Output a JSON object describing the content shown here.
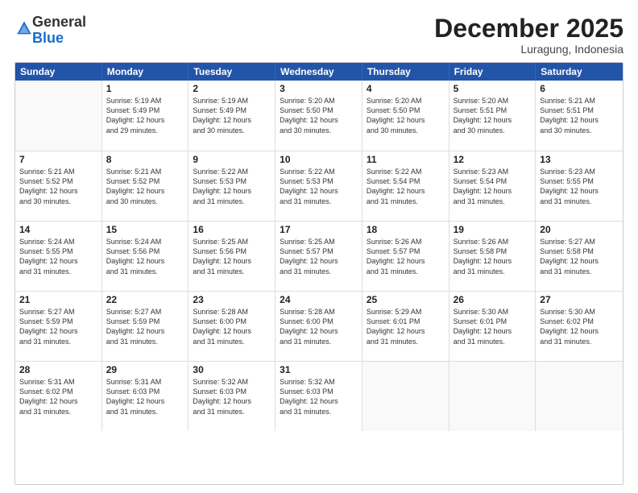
{
  "header": {
    "logo_general": "General",
    "logo_blue": "Blue",
    "month_title": "December 2025",
    "location": "Luragung, Indonesia"
  },
  "days_of_week": [
    "Sunday",
    "Monday",
    "Tuesday",
    "Wednesday",
    "Thursday",
    "Friday",
    "Saturday"
  ],
  "weeks": [
    [
      {
        "day": null,
        "info": null
      },
      {
        "day": "1",
        "info": "Sunrise: 5:19 AM\nSunset: 5:49 PM\nDaylight: 12 hours\nand 29 minutes."
      },
      {
        "day": "2",
        "info": "Sunrise: 5:19 AM\nSunset: 5:49 PM\nDaylight: 12 hours\nand 30 minutes."
      },
      {
        "day": "3",
        "info": "Sunrise: 5:20 AM\nSunset: 5:50 PM\nDaylight: 12 hours\nand 30 minutes."
      },
      {
        "day": "4",
        "info": "Sunrise: 5:20 AM\nSunset: 5:50 PM\nDaylight: 12 hours\nand 30 minutes."
      },
      {
        "day": "5",
        "info": "Sunrise: 5:20 AM\nSunset: 5:51 PM\nDaylight: 12 hours\nand 30 minutes."
      },
      {
        "day": "6",
        "info": "Sunrise: 5:21 AM\nSunset: 5:51 PM\nDaylight: 12 hours\nand 30 minutes."
      }
    ],
    [
      {
        "day": "7",
        "info": "Sunrise: 5:21 AM\nSunset: 5:52 PM\nDaylight: 12 hours\nand 30 minutes."
      },
      {
        "day": "8",
        "info": "Sunrise: 5:21 AM\nSunset: 5:52 PM\nDaylight: 12 hours\nand 30 minutes."
      },
      {
        "day": "9",
        "info": "Sunrise: 5:22 AM\nSunset: 5:53 PM\nDaylight: 12 hours\nand 31 minutes."
      },
      {
        "day": "10",
        "info": "Sunrise: 5:22 AM\nSunset: 5:53 PM\nDaylight: 12 hours\nand 31 minutes."
      },
      {
        "day": "11",
        "info": "Sunrise: 5:22 AM\nSunset: 5:54 PM\nDaylight: 12 hours\nand 31 minutes."
      },
      {
        "day": "12",
        "info": "Sunrise: 5:23 AM\nSunset: 5:54 PM\nDaylight: 12 hours\nand 31 minutes."
      },
      {
        "day": "13",
        "info": "Sunrise: 5:23 AM\nSunset: 5:55 PM\nDaylight: 12 hours\nand 31 minutes."
      }
    ],
    [
      {
        "day": "14",
        "info": "Sunrise: 5:24 AM\nSunset: 5:55 PM\nDaylight: 12 hours\nand 31 minutes."
      },
      {
        "day": "15",
        "info": "Sunrise: 5:24 AM\nSunset: 5:56 PM\nDaylight: 12 hours\nand 31 minutes."
      },
      {
        "day": "16",
        "info": "Sunrise: 5:25 AM\nSunset: 5:56 PM\nDaylight: 12 hours\nand 31 minutes."
      },
      {
        "day": "17",
        "info": "Sunrise: 5:25 AM\nSunset: 5:57 PM\nDaylight: 12 hours\nand 31 minutes."
      },
      {
        "day": "18",
        "info": "Sunrise: 5:26 AM\nSunset: 5:57 PM\nDaylight: 12 hours\nand 31 minutes."
      },
      {
        "day": "19",
        "info": "Sunrise: 5:26 AM\nSunset: 5:58 PM\nDaylight: 12 hours\nand 31 minutes."
      },
      {
        "day": "20",
        "info": "Sunrise: 5:27 AM\nSunset: 5:58 PM\nDaylight: 12 hours\nand 31 minutes."
      }
    ],
    [
      {
        "day": "21",
        "info": "Sunrise: 5:27 AM\nSunset: 5:59 PM\nDaylight: 12 hours\nand 31 minutes."
      },
      {
        "day": "22",
        "info": "Sunrise: 5:27 AM\nSunset: 5:59 PM\nDaylight: 12 hours\nand 31 minutes."
      },
      {
        "day": "23",
        "info": "Sunrise: 5:28 AM\nSunset: 6:00 PM\nDaylight: 12 hours\nand 31 minutes."
      },
      {
        "day": "24",
        "info": "Sunrise: 5:28 AM\nSunset: 6:00 PM\nDaylight: 12 hours\nand 31 minutes."
      },
      {
        "day": "25",
        "info": "Sunrise: 5:29 AM\nSunset: 6:01 PM\nDaylight: 12 hours\nand 31 minutes."
      },
      {
        "day": "26",
        "info": "Sunrise: 5:30 AM\nSunset: 6:01 PM\nDaylight: 12 hours\nand 31 minutes."
      },
      {
        "day": "27",
        "info": "Sunrise: 5:30 AM\nSunset: 6:02 PM\nDaylight: 12 hours\nand 31 minutes."
      }
    ],
    [
      {
        "day": "28",
        "info": "Sunrise: 5:31 AM\nSunset: 6:02 PM\nDaylight: 12 hours\nand 31 minutes."
      },
      {
        "day": "29",
        "info": "Sunrise: 5:31 AM\nSunset: 6:03 PM\nDaylight: 12 hours\nand 31 minutes."
      },
      {
        "day": "30",
        "info": "Sunrise: 5:32 AM\nSunset: 6:03 PM\nDaylight: 12 hours\nand 31 minutes."
      },
      {
        "day": "31",
        "info": "Sunrise: 5:32 AM\nSunset: 6:03 PM\nDaylight: 12 hours\nand 31 minutes."
      },
      {
        "day": null,
        "info": null
      },
      {
        "day": null,
        "info": null
      },
      {
        "day": null,
        "info": null
      }
    ]
  ]
}
